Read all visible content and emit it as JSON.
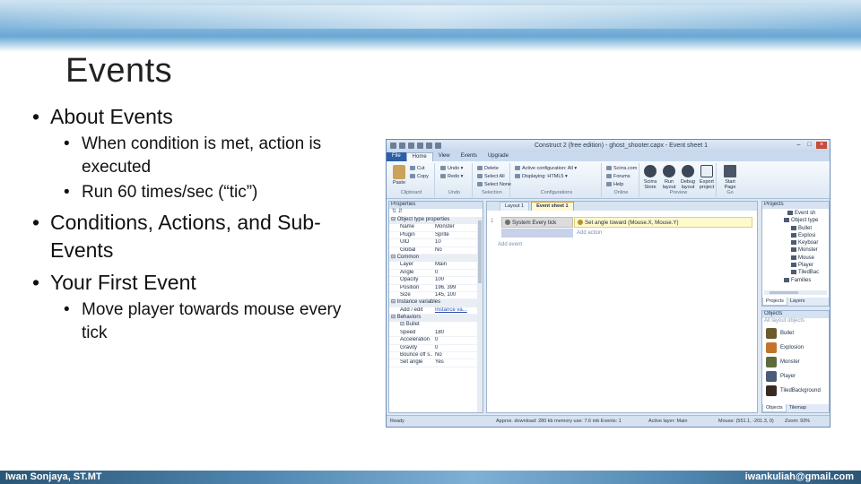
{
  "slide": {
    "title": "Events",
    "bullets": {
      "about_events": "About Events",
      "condition_action": "When condition is met, action is executed",
      "run_rate": "Run 60 times/sec (“tic”)",
      "conditions_actions": "Conditions, Actions, and Sub-Events",
      "first_event": "Your First Event",
      "move_player": "Move player towards mouse every tick"
    },
    "footer": {
      "author": "Iwan Sonjaya, ST.MT",
      "email": "iwankuliah@gmail.com"
    },
    "colors": {
      "band": "#6aa7d4",
      "footer": "#4f86b0"
    }
  },
  "app": {
    "window_title": "Construct 2 (free edition) - ghost_shooter.capx - Event sheet 1",
    "window_controls": {
      "minimize": "–",
      "maximize": "□",
      "close": "×"
    },
    "menu_tabs": [
      "File",
      "Home",
      "View",
      "Events",
      "Upgrade"
    ],
    "ribbon": {
      "clipboard": {
        "paste": "Paste",
        "cut": "Cut",
        "copy": "Copy",
        "label": "Clipboard"
      },
      "undo": {
        "undo": "Undo ▾",
        "redo": "Redo ▾",
        "label": "Undo"
      },
      "selection": {
        "delete": "Delete",
        "select_all": "Select All",
        "select_none": "Select None",
        "label": "Selection"
      },
      "configurations": {
        "active": "Active configuration: All ▾",
        "displaying": "Displaying: HTML5 ▾",
        "label": "Configurations"
      },
      "online": {
        "scirra": "Scirra.com",
        "forums": "Forums",
        "help": "Help",
        "label": "Online"
      },
      "preview": {
        "store": "Scirra Store",
        "run": "Run layout",
        "debug": "Debug layout",
        "export": "Export project",
        "label": "Preview"
      },
      "go": {
        "start": "Start Page",
        "label": "Go"
      }
    },
    "properties": {
      "header": "Properties",
      "toolbar": "⇅ ⇵",
      "sections": {
        "object_type": "Object type properties",
        "common": "Common",
        "instance_vars": "Instance variables",
        "behaviors": "Behaviors",
        "bullet": "Bullet"
      },
      "object_type_rows": [
        {
          "k": "Name",
          "v": "Monster"
        },
        {
          "k": "Plugin",
          "v": "Sprite"
        },
        {
          "k": "UID",
          "v": "10"
        },
        {
          "k": "Global",
          "v": "No"
        }
      ],
      "common_rows": [
        {
          "k": "Layer",
          "v": "Main"
        },
        {
          "k": "Angle",
          "v": "0"
        },
        {
          "k": "Opacity",
          "v": "100"
        },
        {
          "k": "Position",
          "v": "196, 399"
        },
        {
          "k": "Size",
          "v": "145, 100"
        }
      ],
      "instance_row": {
        "k": "Add / edit",
        "v": "Instance va..."
      },
      "bullet_rows": [
        {
          "k": "Speed",
          "v": "180"
        },
        {
          "k": "Acceleration",
          "v": "0"
        },
        {
          "k": "Gravity",
          "v": "0"
        },
        {
          "k": "Bounce off s...",
          "v": "No"
        },
        {
          "k": "Set angle",
          "v": "Yes"
        }
      ]
    },
    "doc_tabs": [
      "Layout 1",
      "Event sheet 1"
    ],
    "event": {
      "number": "1",
      "condition": "System  Every tick",
      "action": "Set angle toward (Mouse.X, Mouse.Y)",
      "add_action": "Add action",
      "add_event": "Add event"
    },
    "projects": {
      "header": "Projects",
      "items": [
        {
          "label": "Event sh",
          "level": 0
        },
        {
          "label": "Object type",
          "level": 1
        },
        {
          "label": "Bullet",
          "level": 2
        },
        {
          "label": "Explosi",
          "level": 2
        },
        {
          "label": "Keyboar",
          "level": 2
        },
        {
          "label": "Monster",
          "level": 2
        },
        {
          "label": "Mouse",
          "level": 2
        },
        {
          "label": "Player",
          "level": 2
        },
        {
          "label": "TiledBac",
          "level": 2
        },
        {
          "label": "Families",
          "level": 1
        }
      ],
      "tabs": [
        "Projects",
        "Layers"
      ]
    },
    "objects": {
      "header": "Objects",
      "filter": "All layout objects",
      "items": [
        {
          "label": "Bullet",
          "color": "#6b5a2c"
        },
        {
          "label": "Explosion",
          "color": "#c2752a"
        },
        {
          "label": "Monster",
          "color": "#5d6b3a"
        },
        {
          "label": "Player",
          "color": "#4b5b7a"
        },
        {
          "label": "TiledBackground",
          "color": "#3a2b22"
        }
      ],
      "tabs": [
        "Objects",
        "Tilemap"
      ]
    },
    "status": {
      "ready": "Ready",
      "approx": "Approx. download: 280 kb  memory use: 7.6 mb   Events: 1",
      "active_layer": "Active layer: Main",
      "mouse": "Mouse: (551.1, -201.3, 0)",
      "zoom": "Zoom: 93%"
    }
  }
}
